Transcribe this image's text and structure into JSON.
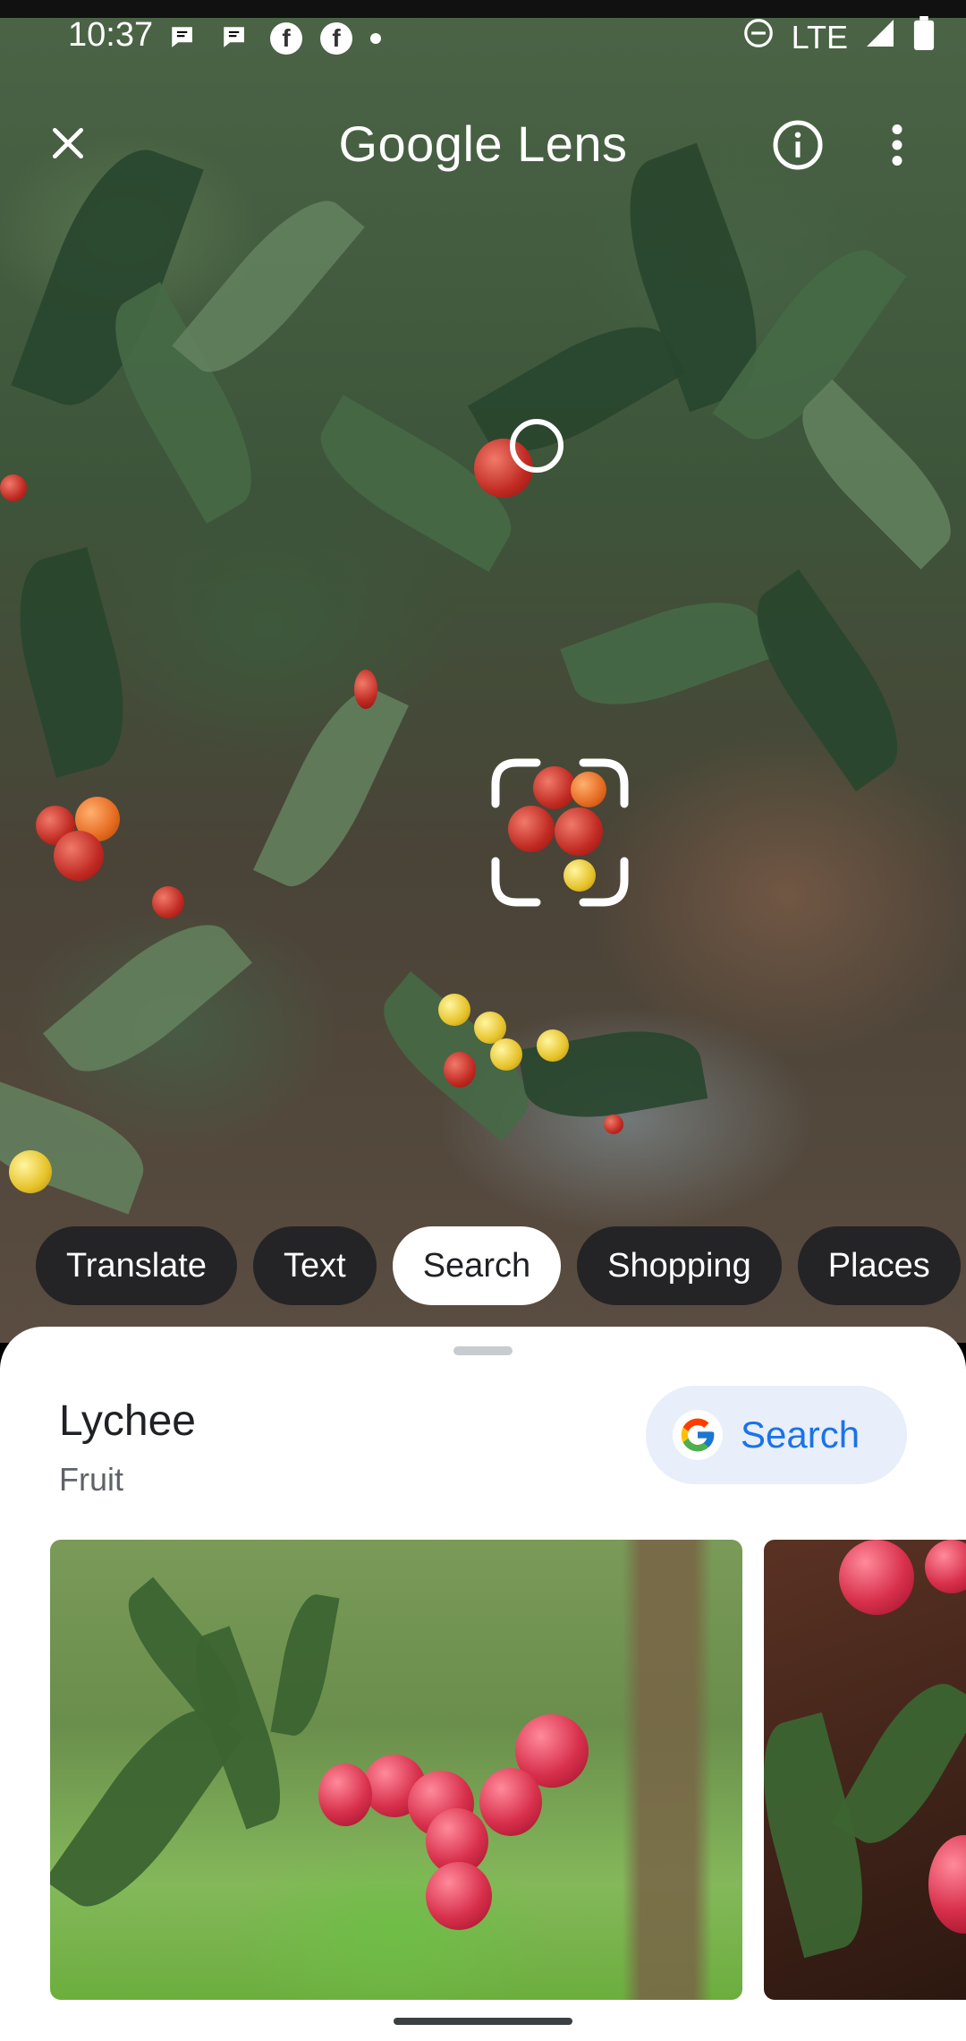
{
  "status_bar": {
    "time": "10:37",
    "network": "LTE",
    "icons": [
      "message-icon",
      "message-icon",
      "facebook-icon",
      "facebook-icon",
      "dot-icon",
      "dnd-icon",
      "signal-icon",
      "battery-icon"
    ]
  },
  "header": {
    "title": "Google Lens",
    "close_icon": "close-icon",
    "info_icon": "info-icon",
    "more_icon": "more-vert-icon"
  },
  "modes": [
    {
      "label": "Translate",
      "active": false
    },
    {
      "label": "Text",
      "active": false
    },
    {
      "label": "Search",
      "active": true
    },
    {
      "label": "Shopping",
      "active": false
    },
    {
      "label": "Places",
      "active": false
    }
  ],
  "result": {
    "title": "Lychee",
    "subtitle": "Fruit",
    "search_button_label": "Search"
  },
  "colors": {
    "accent": "#1a73e8",
    "search_button_bg": "#e8eefa",
    "chip_bg": "#202124"
  }
}
